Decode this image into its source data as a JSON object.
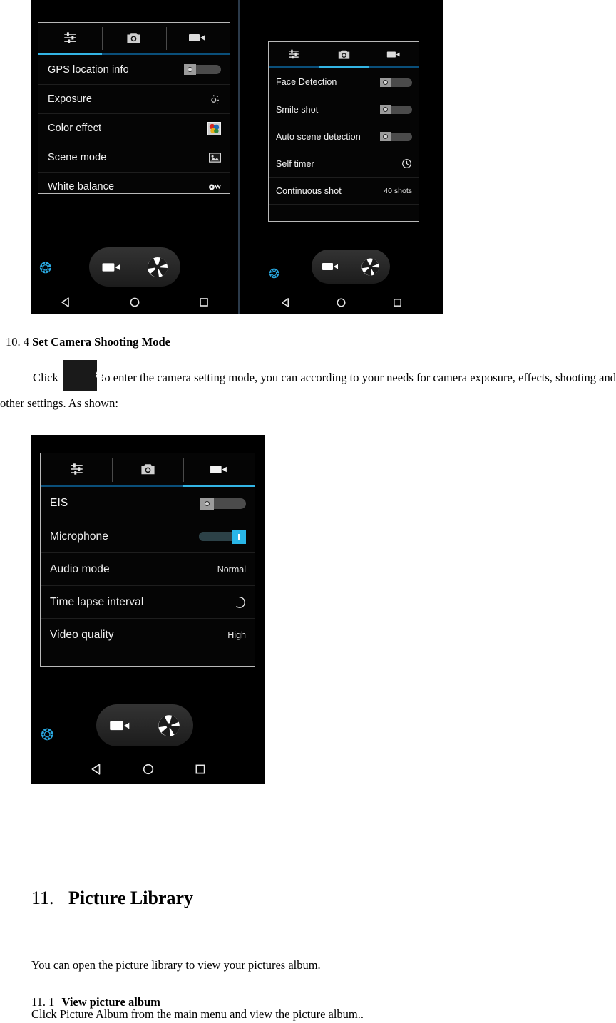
{
  "document": {
    "section_10_4": {
      "number": "10. 4",
      "title": "Set Camera Shooting Mode",
      "body_lead": "Click",
      "gear_icon": "gear-icon",
      "body_rest": "to enter the camera setting mode, you can according to your needs for camera exposure, effects, shooting and other settings. As shown:"
    },
    "section_11": {
      "number": "11.",
      "title": "Picture Library",
      "intro": "You can open the picture library to view your pictures album.",
      "sub_number": "11. 1",
      "sub_title": "View picture album",
      "sub_body": "Click Picture Album from the main menu and view the picture album.."
    }
  },
  "figure_top": {
    "left_phone": {
      "tabs": [
        {
          "icon": "sliders-icon",
          "active": true
        },
        {
          "icon": "camera-icon",
          "active": false
        },
        {
          "icon": "video-camera-icon",
          "active": false
        }
      ],
      "rows": [
        {
          "label": "GPS location info",
          "control": "toggle-off",
          "value": ""
        },
        {
          "label": "Exposure",
          "control": "exposure-icon",
          "value": ""
        },
        {
          "label": "Color effect",
          "control": "color-effect-icon",
          "value": ""
        },
        {
          "label": "Scene mode",
          "control": "scene-mode-icon",
          "value": ""
        },
        {
          "label": "White balance",
          "control": "white-balance-icon",
          "value": ""
        },
        {
          "label": "",
          "control": "partial-row",
          "value": ""
        }
      ],
      "bottom": {
        "gear": "gear-icon",
        "video_button": "video-camera-icon",
        "shutter_button": "aperture-icon",
        "nav": [
          "back-triangle-icon",
          "home-circle-icon",
          "recents-square-icon"
        ]
      }
    },
    "right_phone": {
      "tabs": [
        {
          "icon": "sliders-icon",
          "active": false
        },
        {
          "icon": "camera-icon",
          "active": true
        },
        {
          "icon": "video-camera-icon",
          "active": false
        }
      ],
      "rows": [
        {
          "label": "Face Detection",
          "control": "toggle-off",
          "value": ""
        },
        {
          "label": "Smile shot",
          "control": "toggle-off",
          "value": ""
        },
        {
          "label": "Auto scene detection",
          "control": "toggle-off",
          "value": ""
        },
        {
          "label": "Self timer",
          "control": "clock-icon",
          "value": ""
        },
        {
          "label": "Continuous shot",
          "control": "text",
          "value": "40 shots"
        },
        {
          "label": "",
          "control": "partial-row",
          "value": ""
        }
      ],
      "bottom": {
        "gear": "gear-icon",
        "video_button": "video-camera-icon",
        "shutter_button": "aperture-icon",
        "nav": [
          "back-triangle-icon",
          "home-circle-icon",
          "recents-square-icon"
        ]
      }
    }
  },
  "figure_bottom": {
    "phone": {
      "tabs": [
        {
          "icon": "sliders-icon",
          "active": false
        },
        {
          "icon": "camera-icon",
          "active": false
        },
        {
          "icon": "video-camera-icon",
          "active": true
        }
      ],
      "rows": [
        {
          "label": "EIS",
          "control": "toggle-off",
          "value": ""
        },
        {
          "label": "Microphone",
          "control": "slider-on",
          "value": ""
        },
        {
          "label": "Audio mode",
          "control": "text",
          "value": "Normal"
        },
        {
          "label": "Time lapse interval",
          "control": "timelapse-icon",
          "value": ""
        },
        {
          "label": "Video quality",
          "control": "text",
          "value": "High"
        }
      ],
      "bottom": {
        "gear": "gear-icon",
        "video_button": "video-camera-icon",
        "shutter_button": "aperture-icon",
        "nav": [
          "back-triangle-icon",
          "home-circle-icon",
          "recents-square-icon"
        ]
      }
    }
  },
  "colors": {
    "accent_blue": "#33b5e5",
    "gear_blue": "#29a8e0",
    "inactive_underline": "#0a4f7a",
    "phone_bg": "#000000",
    "card_border": "#b9b9b9"
  }
}
